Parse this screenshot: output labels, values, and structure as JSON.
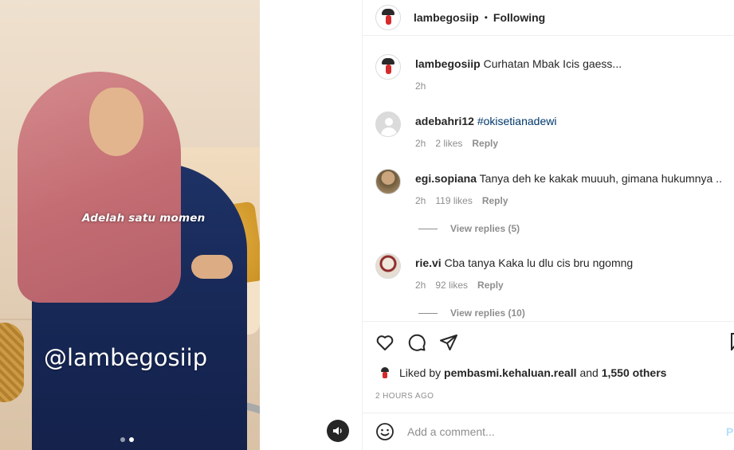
{
  "media": {
    "caption_overlay": "Adelah satu momen",
    "watermark": "@lambegosiip",
    "carousel_index": 2,
    "carousel_count": 2
  },
  "header": {
    "username": "lambegosiip",
    "separator": "•",
    "follow_status": "Following"
  },
  "post_caption": {
    "username": "lambegosiip",
    "text": "Curhatan Mbak Icis gaess...",
    "time": "2h"
  },
  "comments": [
    {
      "username": "adebahri12",
      "text": "#okisetianadewi",
      "time": "2h",
      "likes": "2 likes",
      "reply": "Reply"
    },
    {
      "username": "egi.sopiana",
      "text": "Tanya deh ke kakak muuuh, gimana hukumnya ..",
      "time": "2h",
      "likes": "119 likes",
      "reply": "Reply",
      "view_replies": "View replies (5)"
    },
    {
      "username": "rie.vi",
      "text": "Cba tanya Kaka lu dlu cis bru ngomng",
      "time": "2h",
      "likes": "92 likes",
      "reply": "Reply",
      "view_replies": "View replies (10)"
    }
  ],
  "actions": {
    "liked_by_prefix": "Liked by",
    "liked_by_user": "pembasmi.kehaluan.reall",
    "and": "and",
    "others": "1,550 others",
    "time_ago": "2 HOURS AGO"
  },
  "add_comment": {
    "placeholder": "Add a comment...",
    "post_label": "Po"
  },
  "colors": {
    "link": "#00376b",
    "muted": "#8e8e8e",
    "post_button_disabled": "#b2dffc"
  }
}
